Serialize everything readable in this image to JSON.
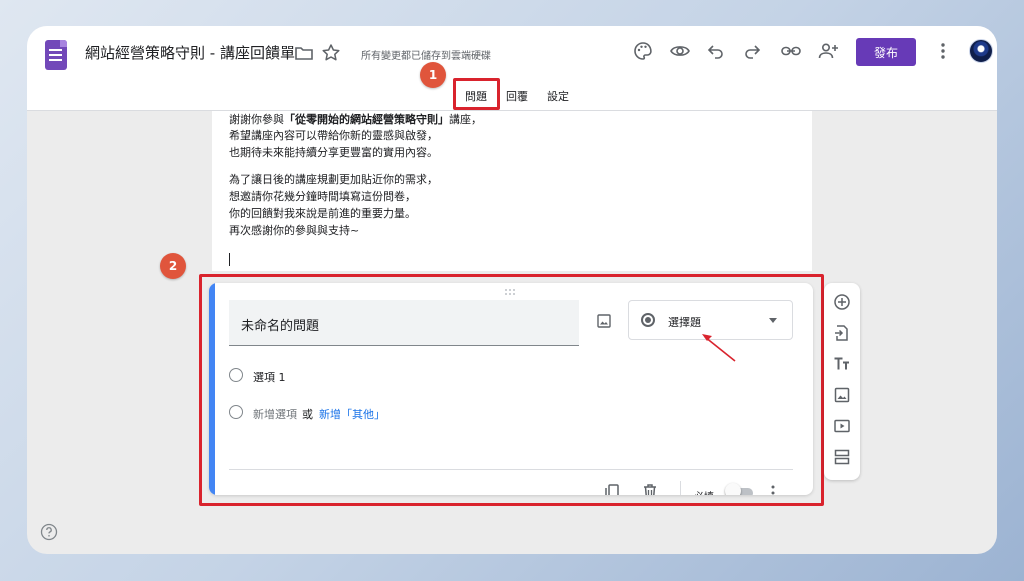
{
  "header": {
    "doc_title": "網站經營策略守則 - 講座回饋單",
    "save_status": "所有變更都已儲存到雲端硬碟",
    "publish_label": "發布"
  },
  "tabs": [
    {
      "label": "問題",
      "active": true
    },
    {
      "label": "回覆",
      "active": false
    },
    {
      "label": "設定",
      "active": false
    }
  ],
  "annotations": {
    "step1": "1",
    "step2": "2"
  },
  "description": {
    "line1_prefix": "謝謝你參與",
    "line1_bold": "「從零開始的網站經營策略守則」",
    "line1_suffix": "講座，",
    "line2": "希望講座內容可以帶給你新的靈感與啟發，",
    "line3": "也期待未來能持續分享更豐富的實用內容。",
    "line4": "為了讓日後的講座規劃更加貼近你的需求，",
    "line5": "想邀請你花幾分鐘時間填寫這份問卷，",
    "line6": "你的回饋對我來說是前進的重要力量。",
    "line7": "再次感謝你的參與與支持~"
  },
  "question": {
    "title": "未命名的問題",
    "type_label": "選擇題",
    "option1": "選項 1",
    "add_option": "新增選項",
    "or_text": "或",
    "add_other": "新增「其他」",
    "required_label": "必填",
    "required": false
  },
  "side_toolbar": [
    "add-question-icon",
    "import-questions-icon",
    "add-title-icon",
    "add-image-icon",
    "add-video-icon",
    "add-section-icon"
  ],
  "colors": {
    "accent": "#673ab7",
    "question_accent": "#4285f4",
    "highlight": "#d9232d",
    "badge": "#e0553c",
    "link": "#1a73e8"
  }
}
